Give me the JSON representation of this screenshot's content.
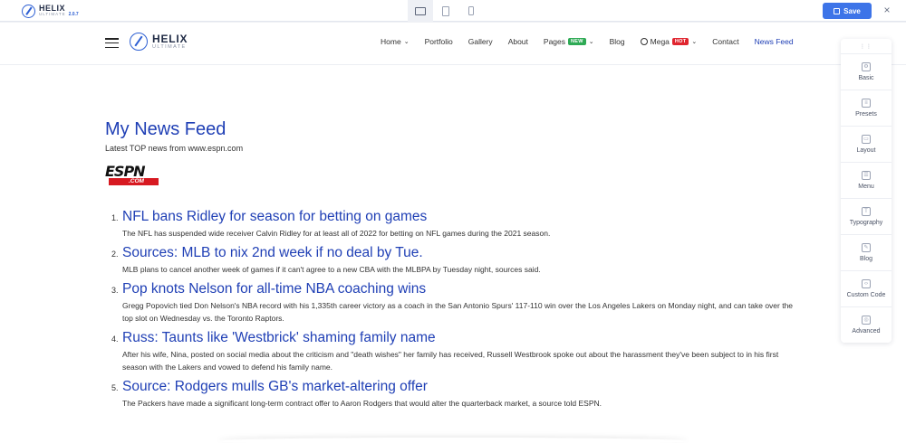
{
  "toolbar": {
    "logo_title": "HELIX",
    "logo_sub": "ULTIMATE",
    "version": "2.0.7",
    "save_label": "Save",
    "close_glyph": "×"
  },
  "site": {
    "logo_title": "HELIX",
    "logo_sub": "ULTIMATE",
    "nav": [
      {
        "label": "Home",
        "dropdown": true
      },
      {
        "label": "Portfolio"
      },
      {
        "label": "Gallery"
      },
      {
        "label": "About"
      },
      {
        "label": "Pages",
        "badge": "NEW",
        "dropdown": true
      },
      {
        "label": "Blog"
      },
      {
        "label": "Mega",
        "badge": "HOT",
        "dropdown": true
      },
      {
        "label": "Contact"
      },
      {
        "label": "News Feed",
        "active": true
      }
    ],
    "nav_chevron": "⌄"
  },
  "main": {
    "title": "My News Feed",
    "subtitle": "Latest TOP news from www.espn.com",
    "espn_logo": "ESPN",
    "espn_logo_sub": ".COM",
    "news": [
      {
        "num": "1.",
        "headline": "NFL bans Ridley for season for betting on games",
        "desc": "The NFL has suspended wide receiver Calvin Ridley for at least all of 2022 for betting on NFL games during the 2021 season."
      },
      {
        "num": "2.",
        "headline": "Sources: MLB to nix 2nd week if no deal by Tue.",
        "desc": "MLB plans to cancel another week of games if it can't agree to a new CBA with the MLBPA by Tuesday night, sources said."
      },
      {
        "num": "3.",
        "headline": "Pop knots Nelson for all-time NBA coaching wins",
        "desc": "Gregg Popovich tied Don Nelson's NBA record with his 1,335th career victory as a coach in the San Antonio Spurs' 117-110 win over the Los Angeles Lakers on Monday night, and can take over the top slot on Wednesday vs. the Toronto Raptors."
      },
      {
        "num": "4.",
        "headline": "Russ: Taunts like 'Westbrick' shaming family name",
        "desc": "After his wife, Nina, posted on social media about the criticism and \"death wishes\" her family has received, Russell Westbrook spoke out about the harassment they've been subject to in his first season with the Lakers and vowed to defend his family name."
      },
      {
        "num": "5.",
        "headline": "Source: Rodgers mulls GB's market-altering offer",
        "desc": "The Packers have made a significant long-term contract offer to Aaron Rodgers that would alter the quarterback market, a source told ESPN."
      }
    ]
  },
  "panel": {
    "drag_glyph": "⋮⋮",
    "items": [
      {
        "label": "Basic",
        "icon": "⚙"
      },
      {
        "label": "Presets",
        "icon": "≡"
      },
      {
        "label": "Layout",
        "icon": "▭"
      },
      {
        "label": "Menu",
        "icon": "☰"
      },
      {
        "label": "Typography",
        "icon": "T"
      },
      {
        "label": "Blog",
        "icon": "✎"
      },
      {
        "label": "Custom Code",
        "icon": "‹›"
      },
      {
        "label": "Advanced",
        "icon": "◎"
      }
    ]
  }
}
